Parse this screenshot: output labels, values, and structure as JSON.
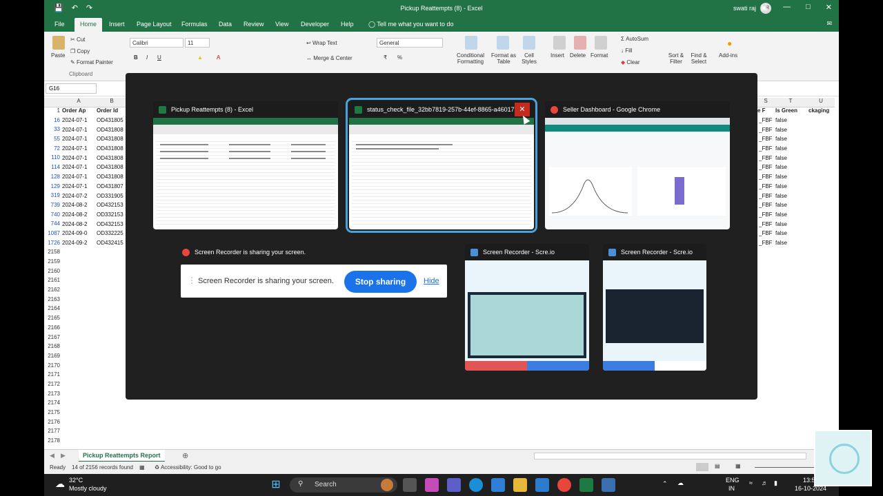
{
  "window": {
    "title": "Pickup Reattempts (8)  -  Excel",
    "user": "swati raj",
    "avatar_initials": "SR"
  },
  "menu_tabs": [
    "File",
    "Home",
    "Insert",
    "Page Layout",
    "Formulas",
    "Data",
    "Review",
    "View",
    "Developer",
    "Help"
  ],
  "tell_me": "Tell me what you want to do",
  "ribbon": {
    "clipboard": {
      "paste": "Paste",
      "cut": "Cut",
      "copy": "Copy",
      "format_painter": "Format Painter",
      "group": "Clipboard"
    },
    "font": {
      "family": "Calibri",
      "size": "11"
    },
    "alignment": {
      "wrap_text": "Wrap Text",
      "merge_center": "Merge & Center"
    },
    "number": {
      "format": "General"
    },
    "styles": {
      "conditional_formatting": "Conditional Formatting",
      "format_as_table": "Format as Table",
      "cell_styles": "Cell Styles"
    },
    "cells": {
      "insert": "Insert",
      "delete": "Delete",
      "format": "Format"
    },
    "editing": {
      "autosum": "AutoSum",
      "fill": "Fill",
      "clear": "Clear",
      "sort_filter": "Sort & Filter",
      "find_select": "Find & Select"
    },
    "addins": {
      "label": "Add-ins"
    }
  },
  "name_box": "G16",
  "columns_left": [
    "A",
    "B"
  ],
  "columns_right": [
    "S",
    "T",
    "U"
  ],
  "header_row": {
    "a": "Order Ap",
    "b": "Order Id",
    "s": "e F",
    "t": "Is Green",
    "u": "ckaging"
  },
  "row_numbers": [
    "1",
    "16",
    "33",
    "55",
    "72",
    "110",
    "114",
    "128",
    "129",
    "319",
    "739",
    "740",
    "744",
    "1087",
    "1726",
    "2158",
    "2159",
    "2160",
    "2161",
    "2162",
    "2163",
    "2164",
    "2165",
    "2166",
    "2167",
    "2168",
    "2169",
    "2170",
    "2171",
    "2172",
    "2173",
    "2174",
    "2175",
    "2176",
    "2177",
    "2178"
  ],
  "col_a": [
    "2024-07-1",
    "2024-07-1",
    "2024-07-1",
    "2024-07-1",
    "2024-07-1",
    "2024-07-1",
    "2024-07-1",
    "2024-07-1",
    "2024-07-2",
    "2024-08-2",
    "2024-08-2",
    "2024-08-2",
    "2024-09-0",
    "2024-09-2"
  ],
  "col_b": [
    "OD431805",
    "OD431808",
    "OD431808",
    "OD431808",
    "OD431808",
    "OD431808",
    "OD431808",
    "OD431807",
    "OD331905",
    "OD432153",
    "OD332153",
    "OD432153",
    "OD332225",
    "OD432415"
  ],
  "col_s": [
    "_FBF",
    "_FBF",
    "_FBF",
    "_FBF",
    "_FBF",
    "_FBF",
    "_FBF",
    "_FBF",
    "_FBF",
    "_FBF",
    "_FBF",
    "_FBF",
    "_FBF",
    "_FBF"
  ],
  "col_t": [
    "false",
    "false",
    "false",
    "false",
    "false",
    "false",
    "false",
    "false",
    "false",
    "false",
    "false",
    "false",
    "false",
    "false"
  ],
  "sheet_tab": "Pickup Reattempts Report",
  "status": {
    "mode": "Ready",
    "records": "14 of 2156 records found",
    "accessibility": "Accessibility: Good to go"
  },
  "task_view": {
    "windows": [
      {
        "title": "Pickup Reattempts (8) - Excel",
        "app": "excel"
      },
      {
        "title": "status_check_file_32bb7819-257b-44ef-8865-a46017...",
        "app": "excel",
        "close": "✕"
      },
      {
        "title": "Seller Dashboard - Google Chrome",
        "app": "chrome"
      },
      {
        "title": "Screen Recorder is sharing your screen.",
        "app": "chrome"
      },
      {
        "title": "Screen Recorder - Scre.io",
        "app": "screcorder"
      },
      {
        "title": "Screen Recorder - Scre.io",
        "app": "screcorder"
      }
    ],
    "sharing": {
      "message": "Screen Recorder is sharing your screen.",
      "stop_label": "Stop sharing",
      "hide_label": "Hide"
    }
  },
  "taskbar": {
    "weather_temp": "32°C",
    "weather_desc": "Mostly cloudy",
    "search_placeholder": "Search",
    "lang_top": "ENG",
    "lang_bottom": "IN",
    "time": "13:5",
    "date": "16-10-2024"
  },
  "colors": {
    "excel_green": "#217346",
    "stop_sharing_blue": "#1a73e8",
    "close_red": "#c42b1c",
    "selected_outline": "#4aa3df"
  }
}
